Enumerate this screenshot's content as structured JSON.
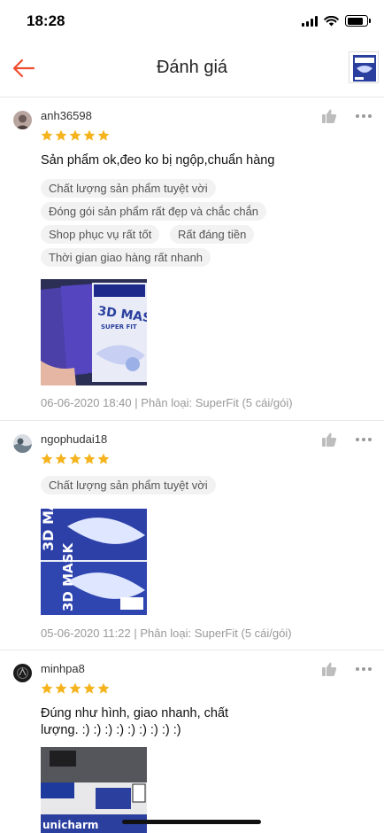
{
  "status_bar": {
    "time": "18:28",
    "battery_level": 0.85
  },
  "header": {
    "title": "Đánh giá",
    "back_icon": "arrow-left-icon",
    "accent_color": "#ee4d2d"
  },
  "icons": {
    "like": "thumb-up-icon",
    "more": "more-horizontal-icon",
    "star": "star-icon"
  },
  "colors": {
    "star": "#f5b41e",
    "tag_bg": "#f2f2f2",
    "meta_text": "#999999"
  },
  "reviews": [
    {
      "username": "anh36598",
      "rating": 5,
      "comment": "Sản phẩm ok,đeo ko bị ngộp,chuẩn hàng",
      "tags": [
        "Chất lượng sản phẩm tuyệt vời",
        "Đóng gói sản phẩm rất đẹp và chắc chắn",
        "Shop phục vụ rất tốt",
        "Rất đáng tiền",
        "Thời gian giao hàng rất nhanh"
      ],
      "timestamp": "06-06-2020 18:40",
      "variant": "Phân loại: SuperFit (5 cái/gói)"
    },
    {
      "username": "ngophudai18",
      "rating": 5,
      "comment": "",
      "tags": [
        "Chất lượng sản phẩm tuyệt vời"
      ],
      "timestamp": "05-06-2020 11:22",
      "variant": "Phân loại: SuperFit (5 cái/gói)"
    },
    {
      "username": "minhpa8",
      "rating": 5,
      "comment": "Đúng như hình, giao nhanh, chất lượng. :) :) :) :) :) :) :) :) :)",
      "tags": []
    }
  ]
}
